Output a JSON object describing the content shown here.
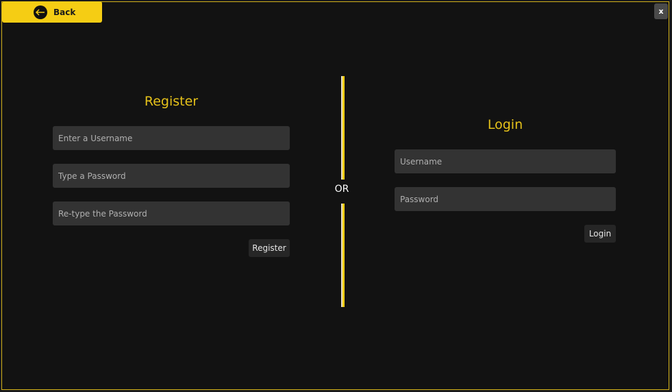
{
  "header": {
    "back_label": "Back",
    "back_icon": "arrow-left-icon",
    "close_label": "x"
  },
  "register": {
    "title": "Register",
    "username_placeholder": "Enter a Username",
    "username_value": "",
    "password_placeholder": "Type a Password",
    "password_value": "",
    "retype_placeholder": "Re-type the Password",
    "retype_value": "",
    "button_label": "Register"
  },
  "separator": {
    "label": "OR"
  },
  "login": {
    "title": "Login",
    "username_placeholder": "Username",
    "username_value": "",
    "password_placeholder": "Password",
    "password_value": "",
    "button_label": "Login"
  },
  "colors": {
    "accent": "#f5cd14",
    "title": "#e6c21a",
    "background": "#121212",
    "field": "#333333",
    "button": "#262626"
  }
}
